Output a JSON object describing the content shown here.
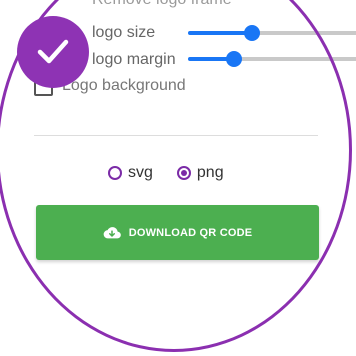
{
  "options": {
    "clipped_label": "Remove logo frame",
    "logo_size_label": "logo size",
    "logo_margin_label": "logo margin",
    "logo_background_label": "Logo background",
    "logo_size_value": 0.4,
    "logo_margin_value": 0.27,
    "logo_background_checked": false
  },
  "format": {
    "options": [
      "svg",
      "png"
    ],
    "selected": "png"
  },
  "download": {
    "label": "DOWNLOAD QR CODE",
    "color": "#4caf50"
  },
  "colors": {
    "accent": "#8e33b4",
    "slider": "#1976f5"
  },
  "icons": {
    "badge": "check-icon",
    "download": "cloud-download-icon"
  }
}
